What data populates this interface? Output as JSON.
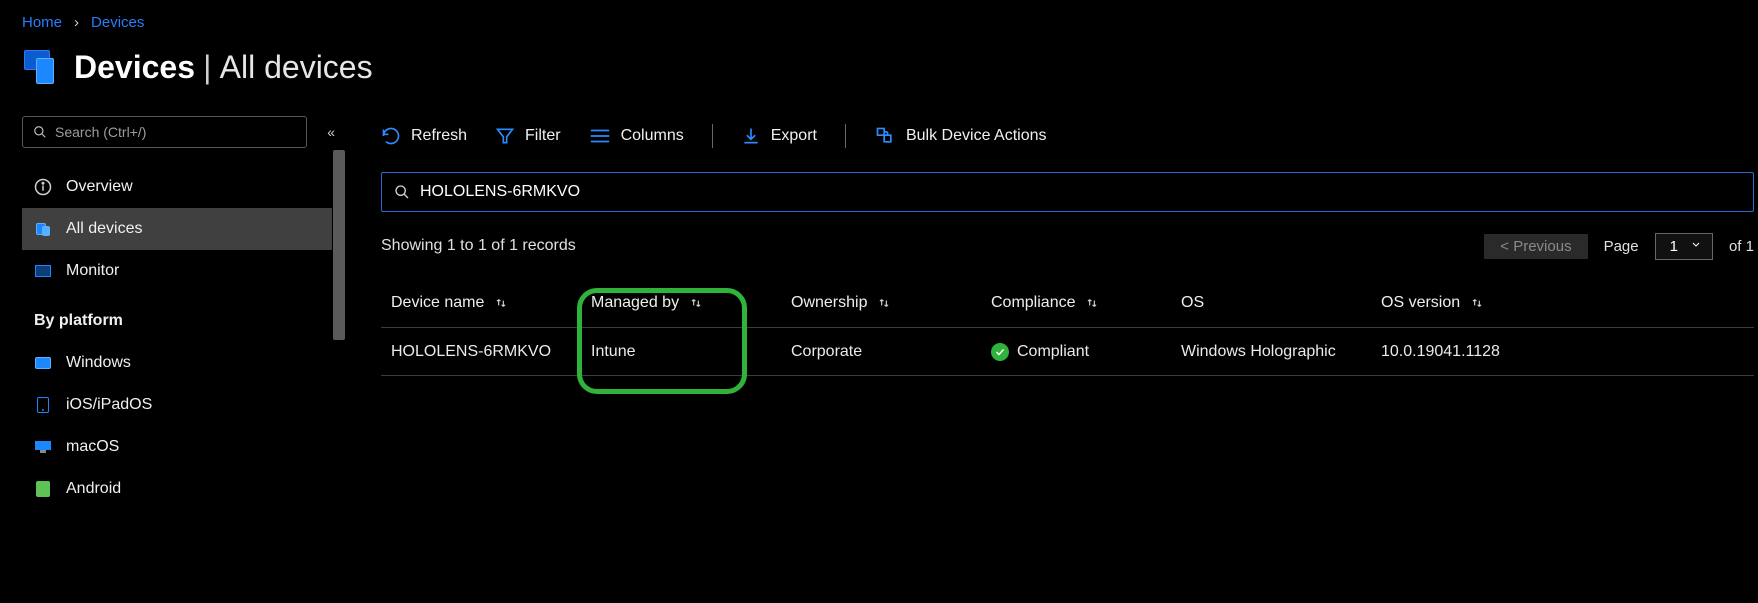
{
  "breadcrumbs": {
    "home": "Home",
    "devices": "Devices"
  },
  "title": {
    "main": "Devices",
    "sub": "All devices"
  },
  "sidebar": {
    "search_placeholder": "Search (Ctrl+/)",
    "items": {
      "overview": "Overview",
      "all_devices": "All devices",
      "monitor": "Monitor"
    },
    "by_platform_header": "By platform",
    "platforms": {
      "windows": "Windows",
      "ios": "iOS/iPadOS",
      "macos": "macOS",
      "android": "Android"
    }
  },
  "toolbar": {
    "refresh": "Refresh",
    "filter": "Filter",
    "columns": "Columns",
    "export": "Export",
    "bulk": "Bulk Device Actions"
  },
  "search": {
    "value": "HOLOLENS-6RMKVO"
  },
  "records_status": "Showing 1 to 1 of 1 records",
  "pager": {
    "prev": "< Previous",
    "page_label": "Page",
    "page_value": "1",
    "of_label": "of 1"
  },
  "table": {
    "headers": {
      "device_name": "Device name",
      "managed_by": "Managed by",
      "ownership": "Ownership",
      "compliance": "Compliance",
      "os": "OS",
      "os_version": "OS version"
    },
    "rows": [
      {
        "device_name": "HOLOLENS-6RMKVO",
        "managed_by": "Intune",
        "ownership": "Corporate",
        "compliance": "Compliant",
        "os": "Windows Holographic",
        "os_version": "10.0.19041.1128"
      }
    ]
  }
}
